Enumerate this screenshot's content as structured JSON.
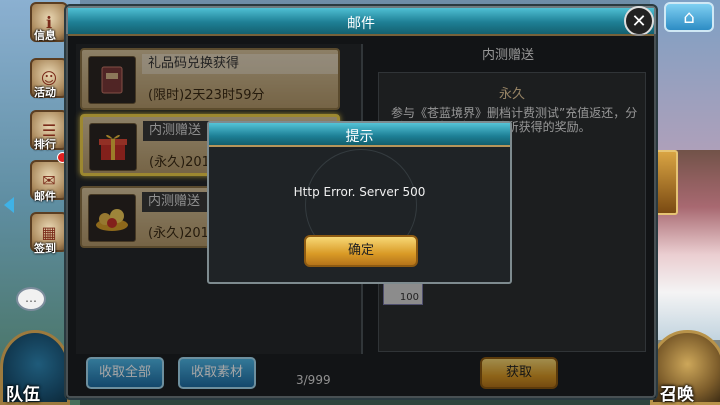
{
  "sidebar": {
    "info": "信息",
    "events": "活动",
    "ranking": "排行",
    "mail": "邮件",
    "signin": "签到"
  },
  "bottom_nav": {
    "team": "队伍",
    "summon": "召唤"
  },
  "mail": {
    "title": "邮件",
    "items": [
      {
        "title": "礼品码兑换获得",
        "sub": "(限时)2天23时59分"
      },
      {
        "title": "内测赠送",
        "sub": "(永久)201"
      },
      {
        "title": "内测赠送",
        "sub": "(永久)201"
      }
    ],
    "detail": {
      "header": "内测赠送",
      "label": "永久",
      "text": "参与《苍蓝境界》删档计费测试”充值返还，分测返还5倍月卡一活动所获得的奖励。",
      "reward_count": "100"
    },
    "buttons": {
      "collect_all": "收取全部",
      "collect_materials": "收取素材",
      "claim": "获取"
    },
    "count": "3/999"
  },
  "dialog": {
    "title": "提示",
    "message": "Http Error. Server 500",
    "confirm": "确定"
  },
  "colors": {
    "accent_teal": "#1e7f95",
    "gold": "#d99a26",
    "highlight": "#f1d24a"
  }
}
